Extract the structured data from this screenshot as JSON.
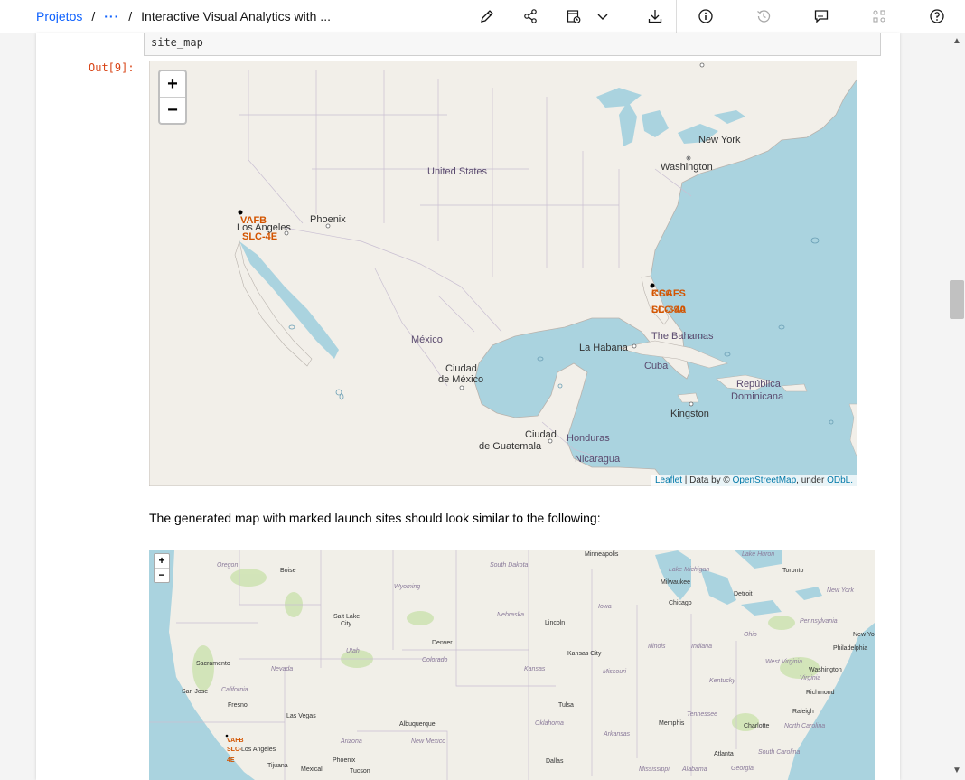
{
  "breadcrumb": {
    "root": "Projetos",
    "separator": "/",
    "ellipsis": "···",
    "current": "Interactive Visual Analytics with ..."
  },
  "toolbar": {
    "icons": [
      "edit-icon",
      "share-icon",
      "schedule-icon",
      "chevron-down-icon",
      "download-icon",
      "info-icon",
      "history-icon",
      "comments-icon",
      "environment-icon",
      "help-icon"
    ]
  },
  "cell": {
    "code": "site_map",
    "out_prompt": "Out[9]:"
  },
  "map1": {
    "zoom_in": "+",
    "zoom_out": "−",
    "labels": {
      "new_york": "New York",
      "washington": "Washington",
      "united_states": "United States",
      "phoenix": "Phoenix",
      "los_angeles": "Los Angeles",
      "mexico": "México",
      "ciudad_mexico_1": "Ciudad",
      "ciudad_mexico_2": "de México",
      "la_habana": "La Habana",
      "bahamas": "The Bahamas",
      "cuba": "Cuba",
      "dominicana_1": "República",
      "dominicana_2": "Dominicana",
      "kingston": "Kingston",
      "guatemala_1": "Ciudad",
      "guatemala_2": "de Guatemala",
      "honduras": "Honduras",
      "nicaragua": "Nicaragua"
    },
    "markers": {
      "vafb": "VAFB",
      "slc4e": "SLC-4E",
      "ccafs": "CCAFS",
      "ksc": "KSC",
      "slc40": "SLC-40",
      "lc39a": "LC-39A"
    },
    "attribution": {
      "leaflet": "Leaflet",
      "middle": " | Data by © ",
      "osm": "OpenStreetMap",
      "under": ", under ",
      "odbl": "ODbL."
    },
    "colors": {
      "water": "#aad3df",
      "land": "#f2efe9",
      "marker_label": "#d35400"
    }
  },
  "markdown": {
    "text": "The generated map with marked launch sites should look similar to the following:"
  },
  "map2": {
    "zoom_in": "+",
    "zoom_out": "−",
    "labels": {
      "minneapolis": "Minneapolis",
      "toronto": "Toronto",
      "oregon": "Oregon",
      "boise": "Boise",
      "south_dakota": "South Dakota",
      "wyoming": "Wyoming",
      "lake_michigan": "Lake Michigan",
      "milwaukee": "Milwaukee",
      "detroit": "Detroit",
      "new_york": "New York",
      "chicago": "Chicago",
      "iowa": "Iowa",
      "nebraska": "Nebraska",
      "lincoln": "Lincoln",
      "salt_lake": "Salt Lake",
      "city": "City",
      "pennsylvania": "Pennsylvania",
      "ohio": "Ohio",
      "illinois": "Illinois",
      "indiana": "Indiana",
      "denver": "Denver",
      "utah": "Utah",
      "philadelphia": "Philadelphia",
      "sacramento": "Sacramento",
      "nevada": "Nevada",
      "colorado": "Colorado",
      "kansas_city": "Kansas City",
      "kansas": "Kansas",
      "missouri": "Missouri",
      "west_virginia": "West Virginia",
      "washington": "Washington",
      "virginia": "Virginia",
      "san_jose": "San Jose",
      "california": "California",
      "kentucky": "Kentucky",
      "richmond": "Richmond",
      "fresno": "Fresno",
      "tulsa": "Tulsa",
      "las_vegas": "Las Vegas",
      "albuquerque": "Albuquerque",
      "oklahoma": "Oklahoma",
      "memphis": "Memphis",
      "tennessee": "Tennessee",
      "raleigh": "Raleigh",
      "charlotte": "Charlotte",
      "north_carolina": "North Carolina",
      "arizona": "Arizona",
      "new_mexico": "New Mexico",
      "arkansas": "Arkansas",
      "los_angeles": "Los Angeles",
      "atlanta": "Atlanta",
      "south_carolina": "South Carolina",
      "phoenix": "Phoenix",
      "tijuana": "Tijuana",
      "mexicali": "Mexicali",
      "tucson": "Tucson",
      "dallas": "Dallas",
      "mississippi": "Mississippi",
      "alabama": "Alabama",
      "georgia": "Georgia",
      "lake_huron": "Lake Huron",
      "vafb": "VAFB",
      "slc": "SLC-",
      "fe": "4E"
    }
  }
}
